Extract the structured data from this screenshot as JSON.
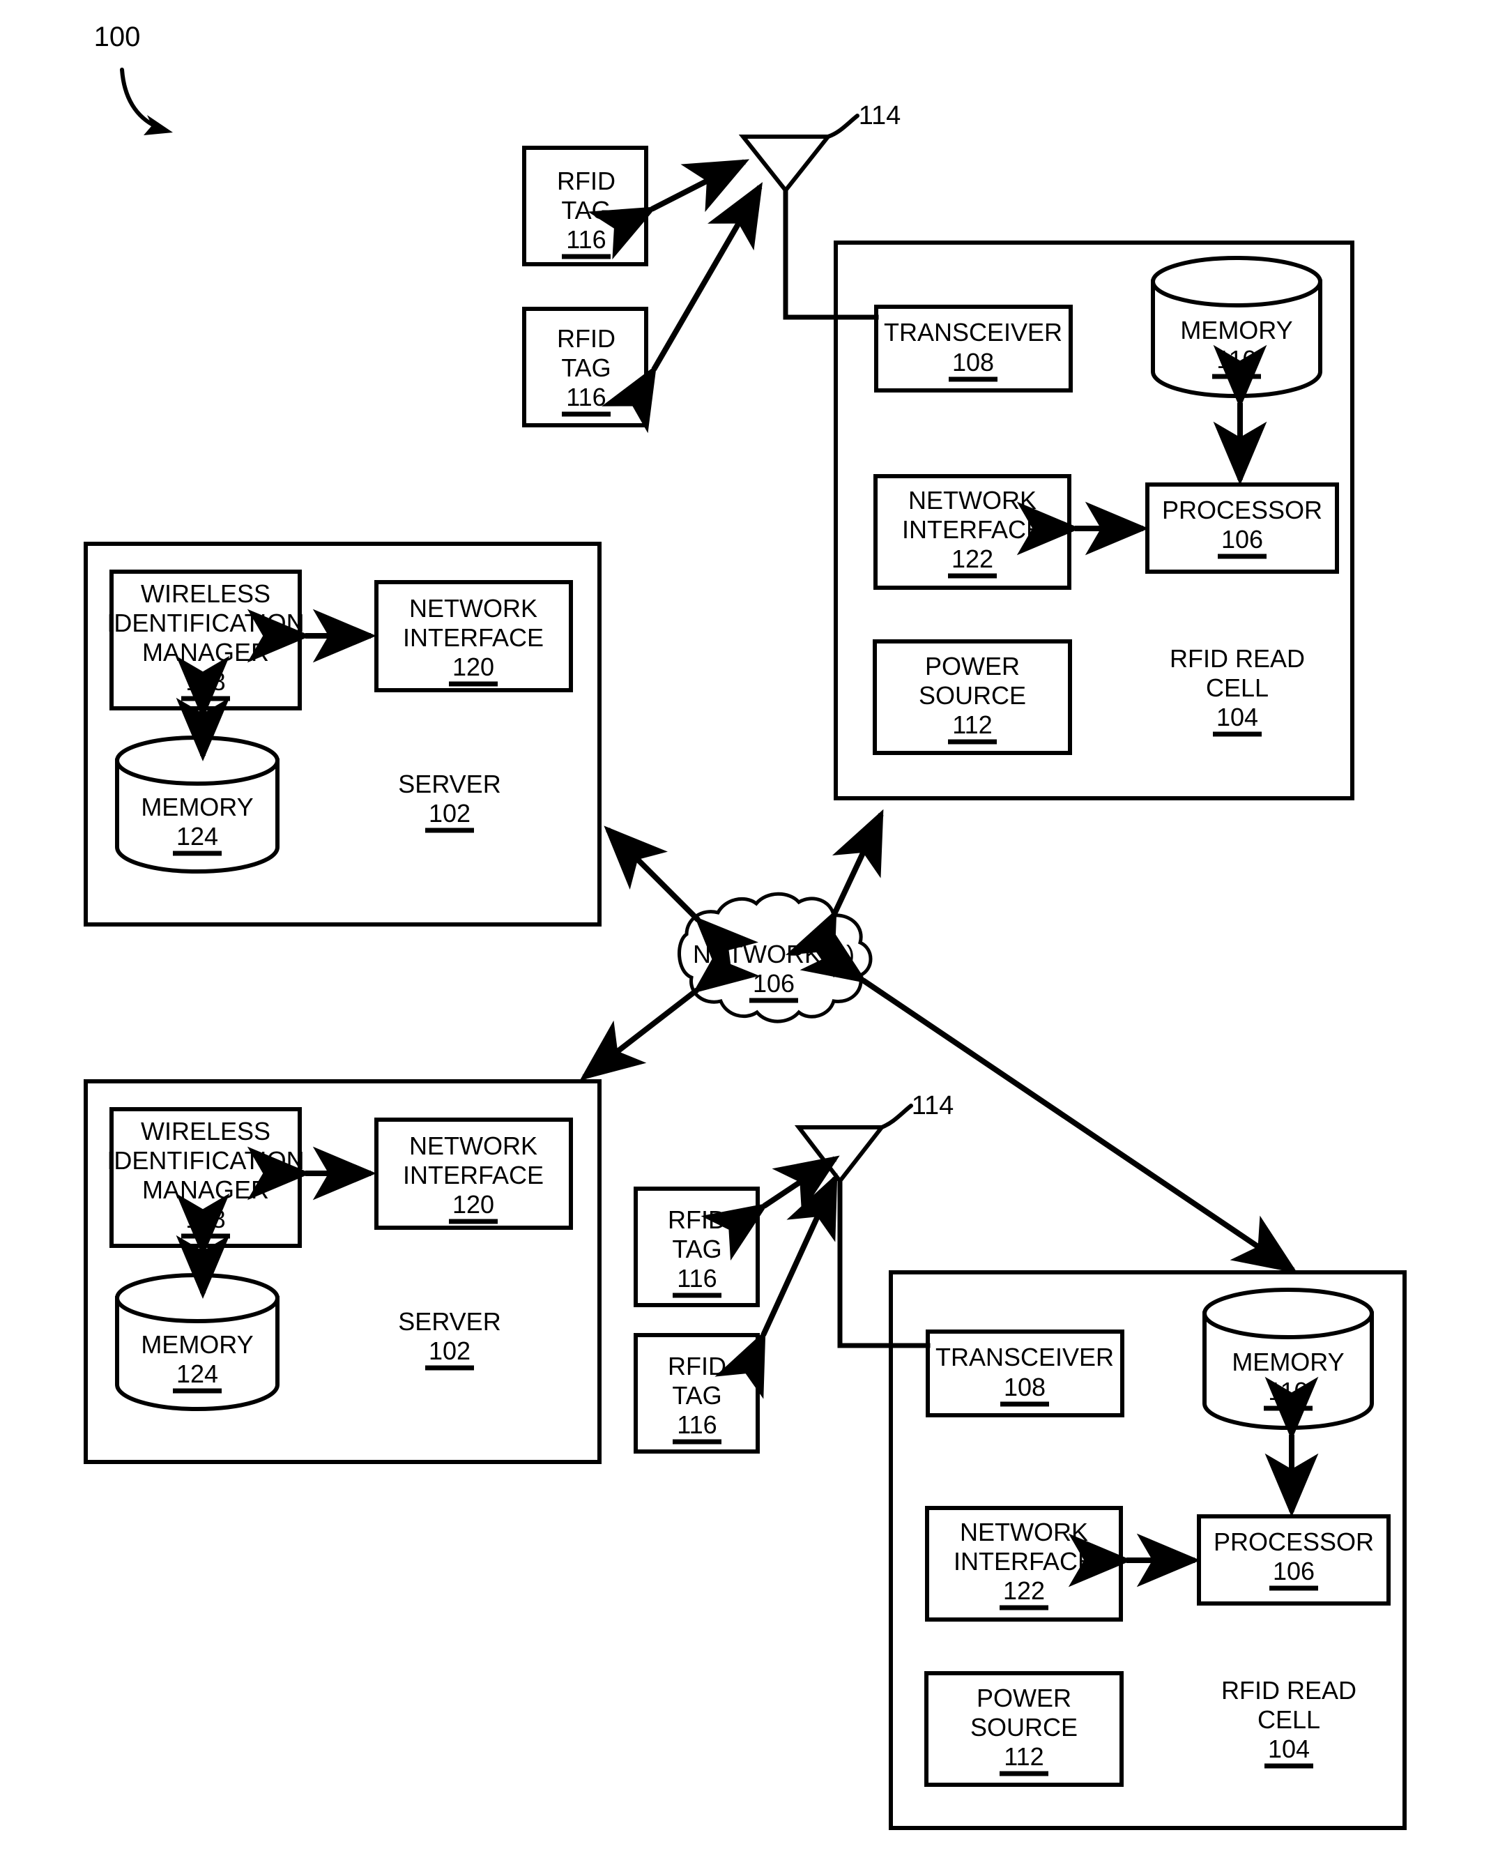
{
  "figure": {
    "number": "100",
    "title_present": false
  },
  "colors": {
    "stroke": "#000000",
    "background": "#ffffff"
  },
  "nodes": {
    "rfid_tag": {
      "line1": "RFID",
      "line2": "TAG",
      "ref": "116"
    },
    "antenna": {
      "ref": "114"
    },
    "transceiver": {
      "label": "TRANSCEIVER",
      "ref": "108"
    },
    "memory_cell": {
      "label": "MEMORY",
      "ref": "110"
    },
    "network_interface_cell": {
      "line1": "NETWORK",
      "line2": "INTERFACE",
      "ref": "122"
    },
    "processor": {
      "label": "PROCESSOR",
      "ref": "106"
    },
    "power_source": {
      "line1": "POWER",
      "line2": "SOURCE",
      "ref": "112"
    },
    "rfid_read_cell": {
      "line1": "RFID READ",
      "line2": "CELL",
      "ref": "104"
    },
    "wireless_identification_manager": {
      "line1": "WIRELESS",
      "line2": "IDENTIFICATION",
      "line3": "MANAGER",
      "ref": "118"
    },
    "network_interface_server": {
      "line1": "NETWORK",
      "line2": "INTERFACE",
      "ref": "120"
    },
    "memory_server": {
      "label": "MEMORY",
      "ref": "124"
    },
    "server": {
      "label": "SERVER",
      "ref": "102"
    },
    "network_cloud": {
      "label": "NETWORK(S)",
      "ref": "106"
    }
  },
  "instances": {
    "top_rfid_tag_1": {
      "line1": "RFID",
      "line2": "TAG",
      "ref": "116"
    },
    "top_rfid_tag_2": {
      "line1": "RFID",
      "line2": "TAG",
      "ref": "116"
    },
    "bottom_rfid_tag_1": {
      "line1": "RFID",
      "line2": "TAG",
      "ref": "116"
    },
    "bottom_rfid_tag_2": {
      "line1": "RFID",
      "line2": "TAG",
      "ref": "116"
    },
    "top_antenna_ref": "114",
    "bottom_antenna_ref": "114",
    "top_transceiver": {
      "label": "TRANSCEIVER",
      "ref": "108"
    },
    "bottom_transceiver": {
      "label": "TRANSCEIVER",
      "ref": "108"
    },
    "top_memory": {
      "label": "MEMORY",
      "ref": "110"
    },
    "bottom_memory": {
      "label": "MEMORY",
      "ref": "110"
    },
    "top_netif_cell": {
      "line1": "NETWORK",
      "line2": "INTERFACE",
      "ref": "122"
    },
    "bottom_netif_cell": {
      "line1": "NETWORK",
      "line2": "INTERFACE",
      "ref": "122"
    },
    "top_processor": {
      "label": "PROCESSOR",
      "ref": "106"
    },
    "bottom_processor": {
      "label": "PROCESSOR",
      "ref": "106"
    },
    "top_power": {
      "line1": "POWER",
      "line2": "SOURCE",
      "ref": "112"
    },
    "bottom_power": {
      "line1": "POWER",
      "line2": "SOURCE",
      "ref": "112"
    },
    "top_cell_title": {
      "line1": "RFID READ",
      "line2": "CELL",
      "ref": "104"
    },
    "bottom_cell_title": {
      "line1": "RFID READ",
      "line2": "CELL",
      "ref": "104"
    },
    "top_wim": {
      "line1": "WIRELESS",
      "line2": "IDENTIFICATION",
      "line3": "MANAGER",
      "ref": "118"
    },
    "bottom_wim": {
      "line1": "WIRELESS",
      "line2": "IDENTIFICATION",
      "line3": "MANAGER",
      "ref": "118"
    },
    "top_netif_server": {
      "line1": "NETWORK",
      "line2": "INTERFACE",
      "ref": "120"
    },
    "bottom_netif_server": {
      "line1": "NETWORK",
      "line2": "INTERFACE",
      "ref": "120"
    },
    "top_server_memory": {
      "label": "MEMORY",
      "ref": "124"
    },
    "bottom_server_memory": {
      "label": "MEMORY",
      "ref": "124"
    },
    "top_server_title": {
      "label": "SERVER",
      "ref": "102"
    },
    "bottom_server_title": {
      "label": "SERVER",
      "ref": "102"
    },
    "cloud": {
      "label": "NETWORK(S)",
      "ref": "106"
    }
  }
}
